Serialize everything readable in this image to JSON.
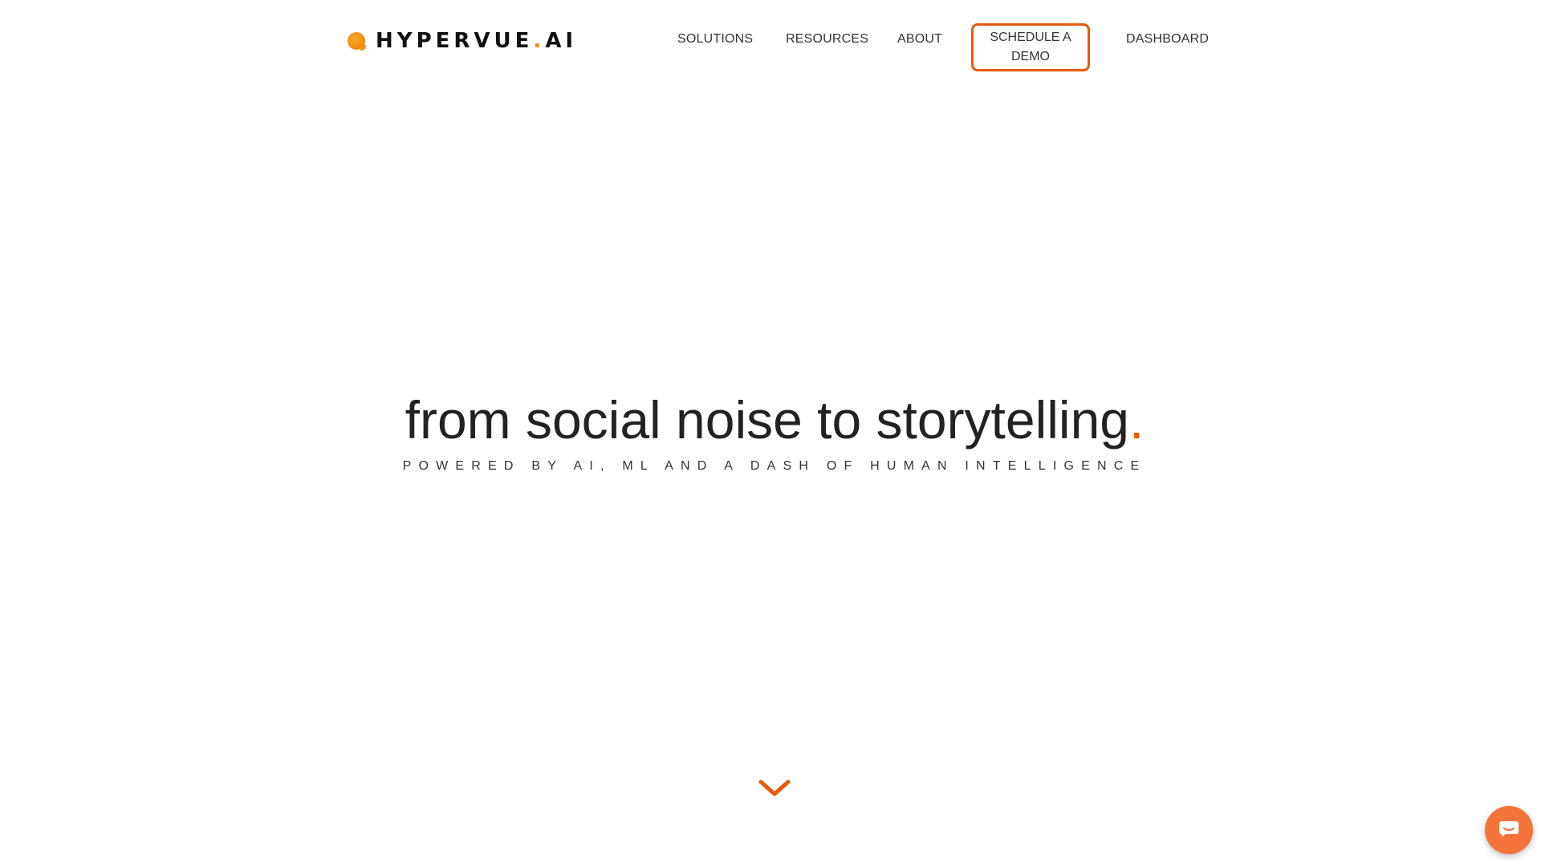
{
  "brand": {
    "name_main": "HYPERVUE",
    "name_dot": ".",
    "name_suffix": "AI",
    "accent_color": "#e8590c",
    "logo_color": "#f29111"
  },
  "nav": {
    "items": [
      {
        "label": "SOLUTIONS"
      },
      {
        "label": "RESOURCES"
      },
      {
        "label": "ABOUT"
      }
    ],
    "cta_label": "SCHEDULE A DEMO",
    "dashboard_label": "DASHBOARD"
  },
  "hero": {
    "title": "from social noise to storytelling",
    "title_dot": ".",
    "subtitle": "POWERED BY AI, ML AND A DASH OF HUMAN INTELLIGENCE"
  },
  "icons": {
    "scroll": "chevron-down-icon",
    "chat": "chat-icon"
  }
}
